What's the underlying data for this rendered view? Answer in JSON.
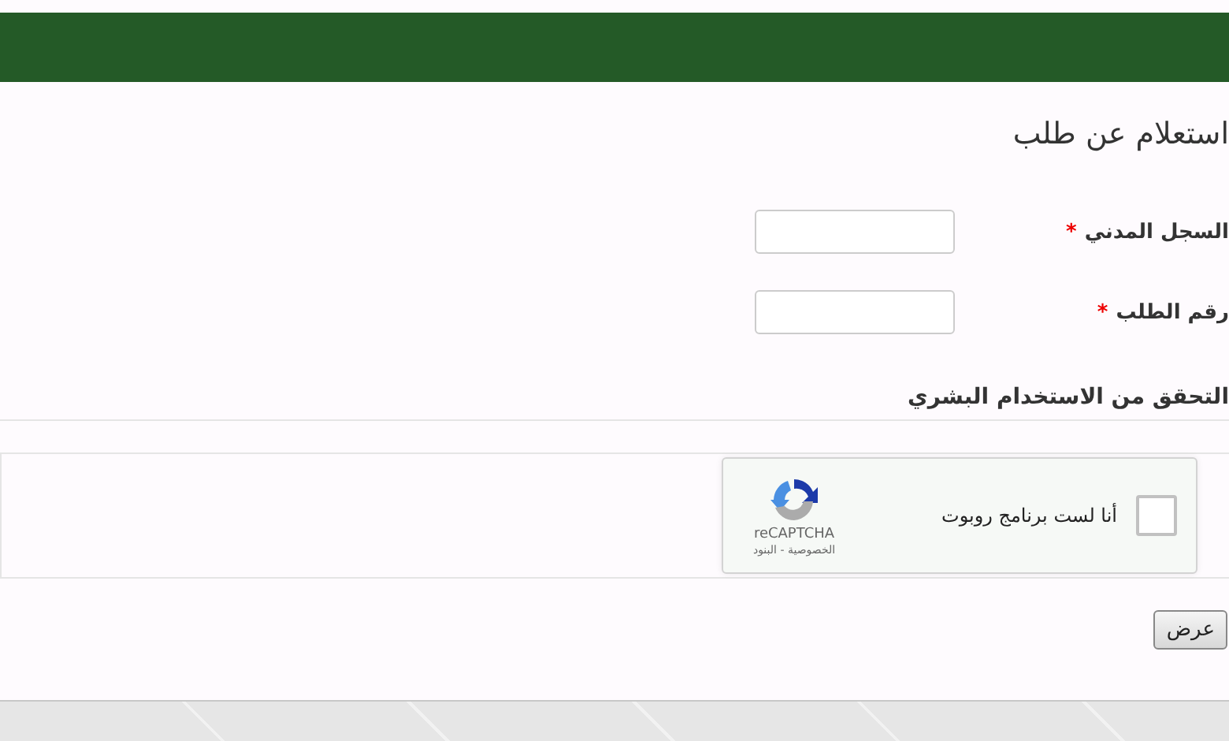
{
  "page_title": "استعلام عن طلب",
  "fields": [
    {
      "label": "السجل المدني",
      "required_mark": "*"
    },
    {
      "label": "رقم الطلب",
      "required_mark": "*"
    }
  ],
  "verification": {
    "heading": "التحقق من الاستخدام البشري",
    "captcha": {
      "label": "أنا لست برنامج روبوت",
      "checked": false,
      "brand": "reCAPTCHA",
      "links": "الخصوصية - البنود"
    }
  },
  "submit_button": "عرض"
}
